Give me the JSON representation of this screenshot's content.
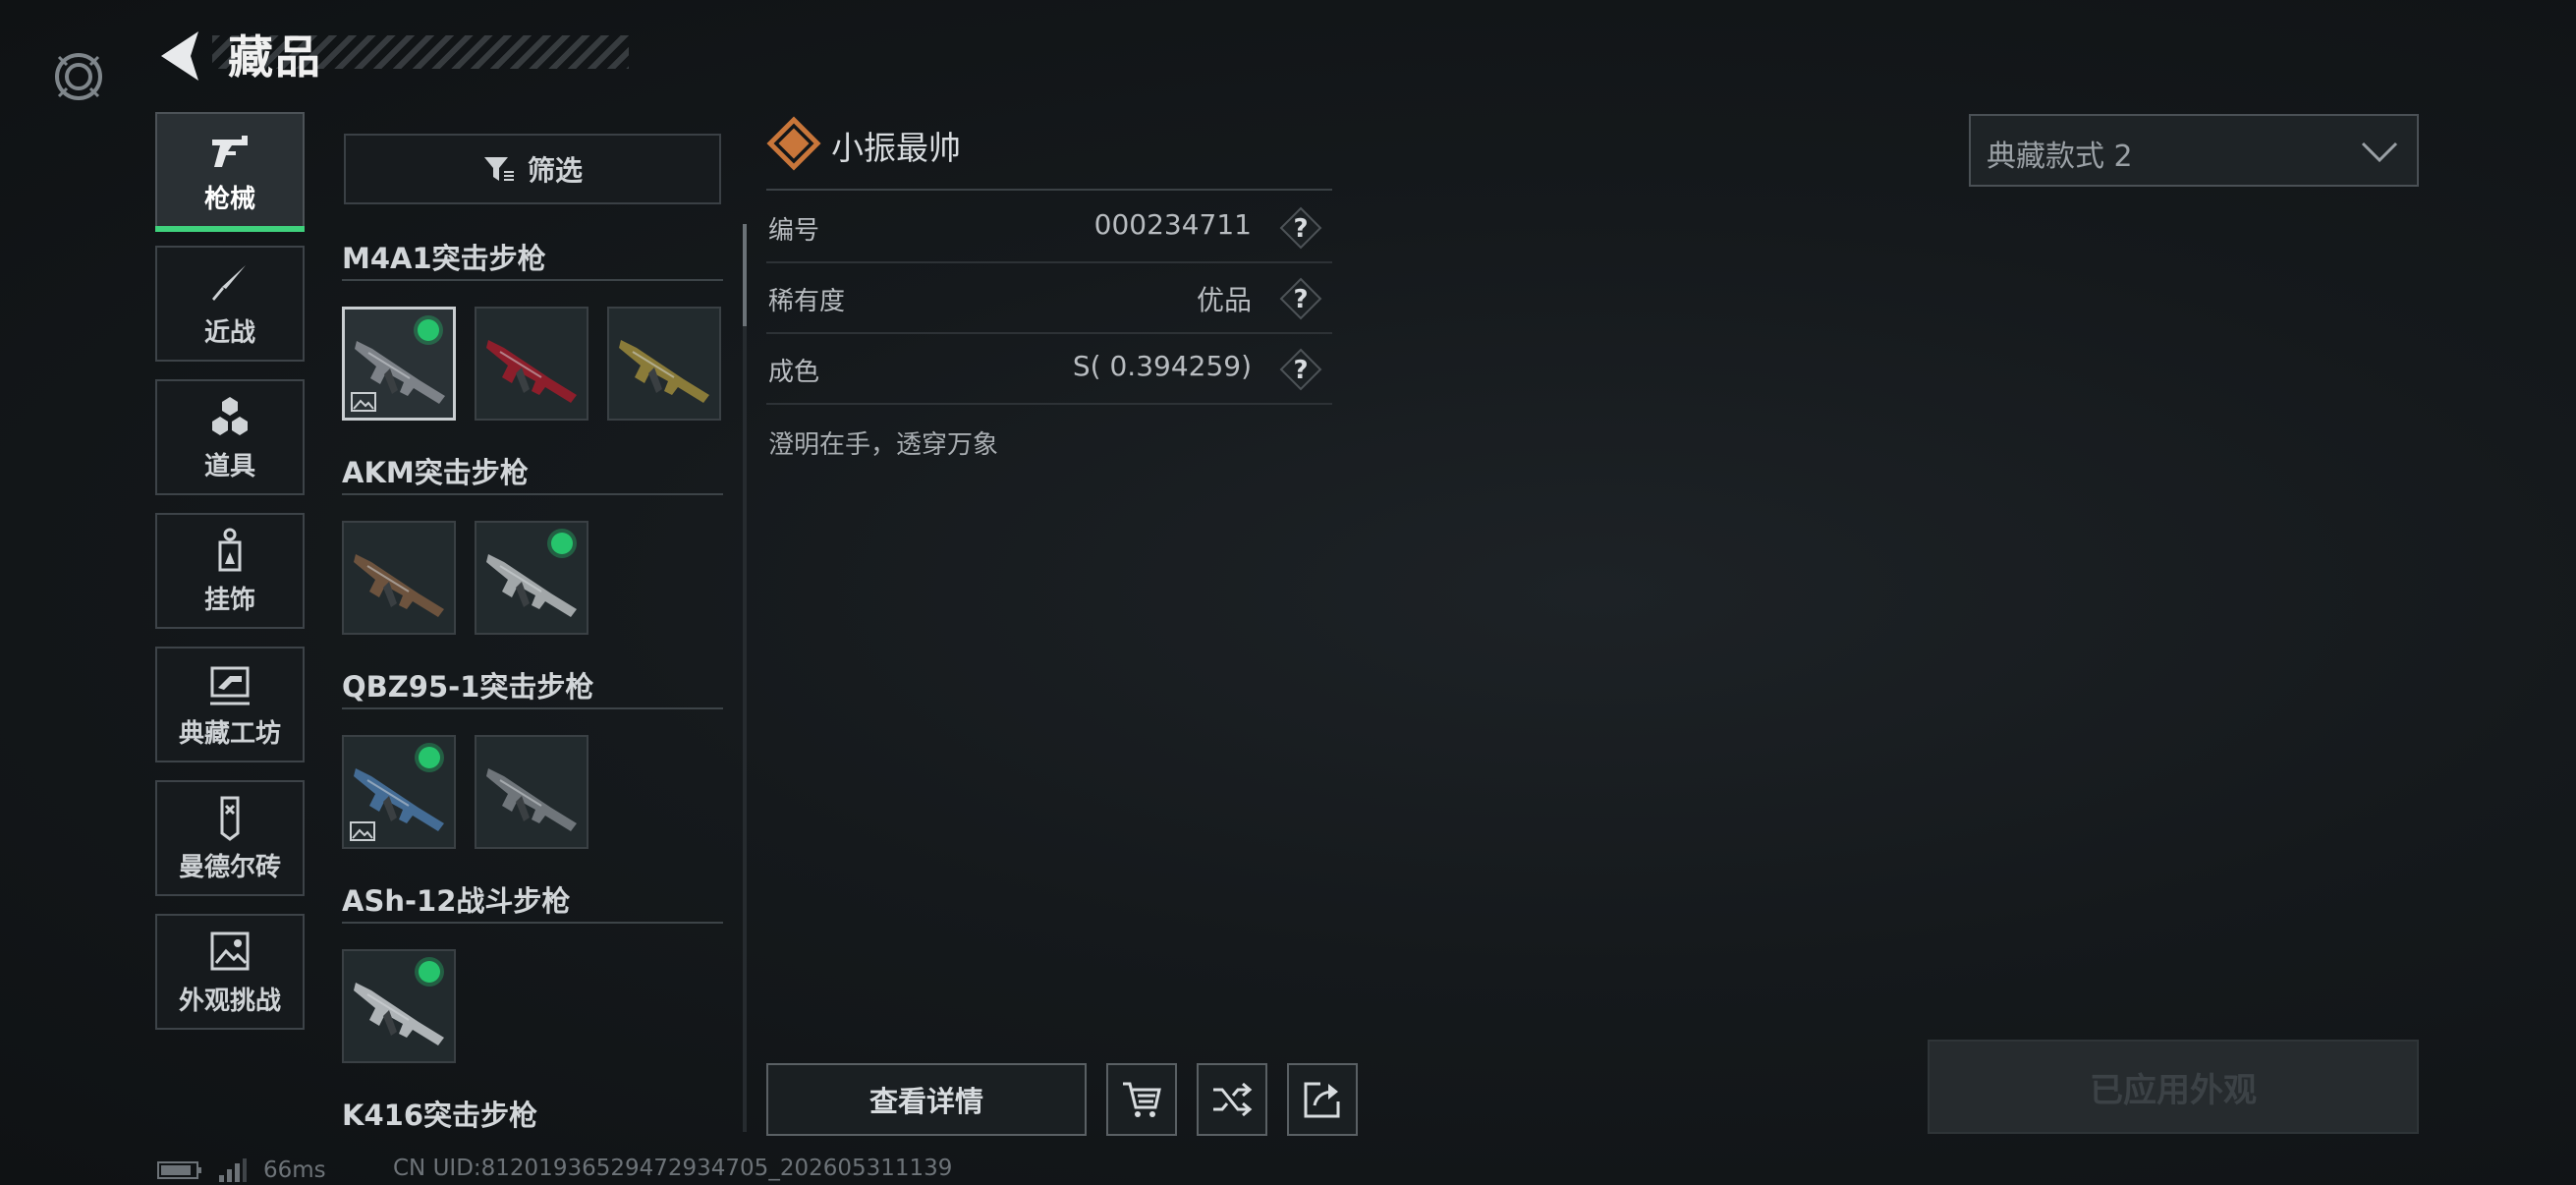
{
  "header": {
    "title": "藏品"
  },
  "categories": [
    {
      "label": "枪械",
      "icon": "pistol-icon",
      "active": true
    },
    {
      "label": "近战",
      "icon": "knife-icon",
      "active": false
    },
    {
      "label": "道具",
      "icon": "grenade-icon",
      "active": false
    },
    {
      "label": "挂饰",
      "icon": "charm-icon",
      "active": false
    },
    {
      "label": "典藏工坊",
      "icon": "frame-icon",
      "active": false
    },
    {
      "label": "曼德尔砖",
      "icon": "brick-icon",
      "active": false
    },
    {
      "label": "外观挑战",
      "icon": "image-challenge-icon",
      "active": false
    }
  ],
  "filter": {
    "label": "筛选"
  },
  "weapon_groups": [
    {
      "title": "M4A1突击步枪",
      "skins": [
        {
          "color": "#8c9196",
          "equipped": true,
          "selected": true,
          "has_picture": true
        },
        {
          "color": "#a01c2c",
          "equipped": false,
          "selected": false,
          "has_picture": false
        },
        {
          "color": "#9c8a3c",
          "equipped": false,
          "selected": false,
          "has_picture": false
        }
      ]
    },
    {
      "title": "AKM突击步枪",
      "skins": [
        {
          "color": "#7a5a42",
          "equipped": false,
          "selected": false,
          "has_picture": false
        },
        {
          "color": "#b8bdc0",
          "equipped": true,
          "selected": false,
          "has_picture": false
        }
      ]
    },
    {
      "title": "QBZ95-1突击步枪",
      "skins": [
        {
          "color": "#4a78a8",
          "equipped": true,
          "selected": false,
          "has_picture": true
        },
        {
          "color": "#7d8388",
          "equipped": false,
          "selected": false,
          "has_picture": false
        }
      ]
    },
    {
      "title": "ASh-12战斗步枪",
      "skins": [
        {
          "color": "#c8ccd0",
          "equipped": true,
          "selected": false,
          "has_picture": false
        }
      ]
    },
    {
      "title": "K416突击步枪",
      "skins": []
    }
  ],
  "item_info": {
    "owner_name": "小振最帅",
    "rarity_icon": "rarity-diamond-icon",
    "rarity_color": "#c9763a",
    "rows": [
      {
        "key": "编号",
        "value": "000234711"
      },
      {
        "key": "稀有度",
        "value": "优品"
      },
      {
        "key": "成色",
        "value": "S( 0.394259)"
      }
    ],
    "description": "澄明在手，透穿万象"
  },
  "actions": {
    "details_label": "查看详情",
    "icons": [
      "cart-icon",
      "shuffle-icon",
      "share-icon"
    ]
  },
  "style_select": {
    "value": "典藏款式 2"
  },
  "applied_button": {
    "label": "已应用外观"
  },
  "status": {
    "ping": "66ms",
    "uid": "CN UID:8120193652947293470​5_202605311139"
  },
  "colors": {
    "accent": "#3fd17c",
    "equipped_dot": "#26c46c"
  }
}
